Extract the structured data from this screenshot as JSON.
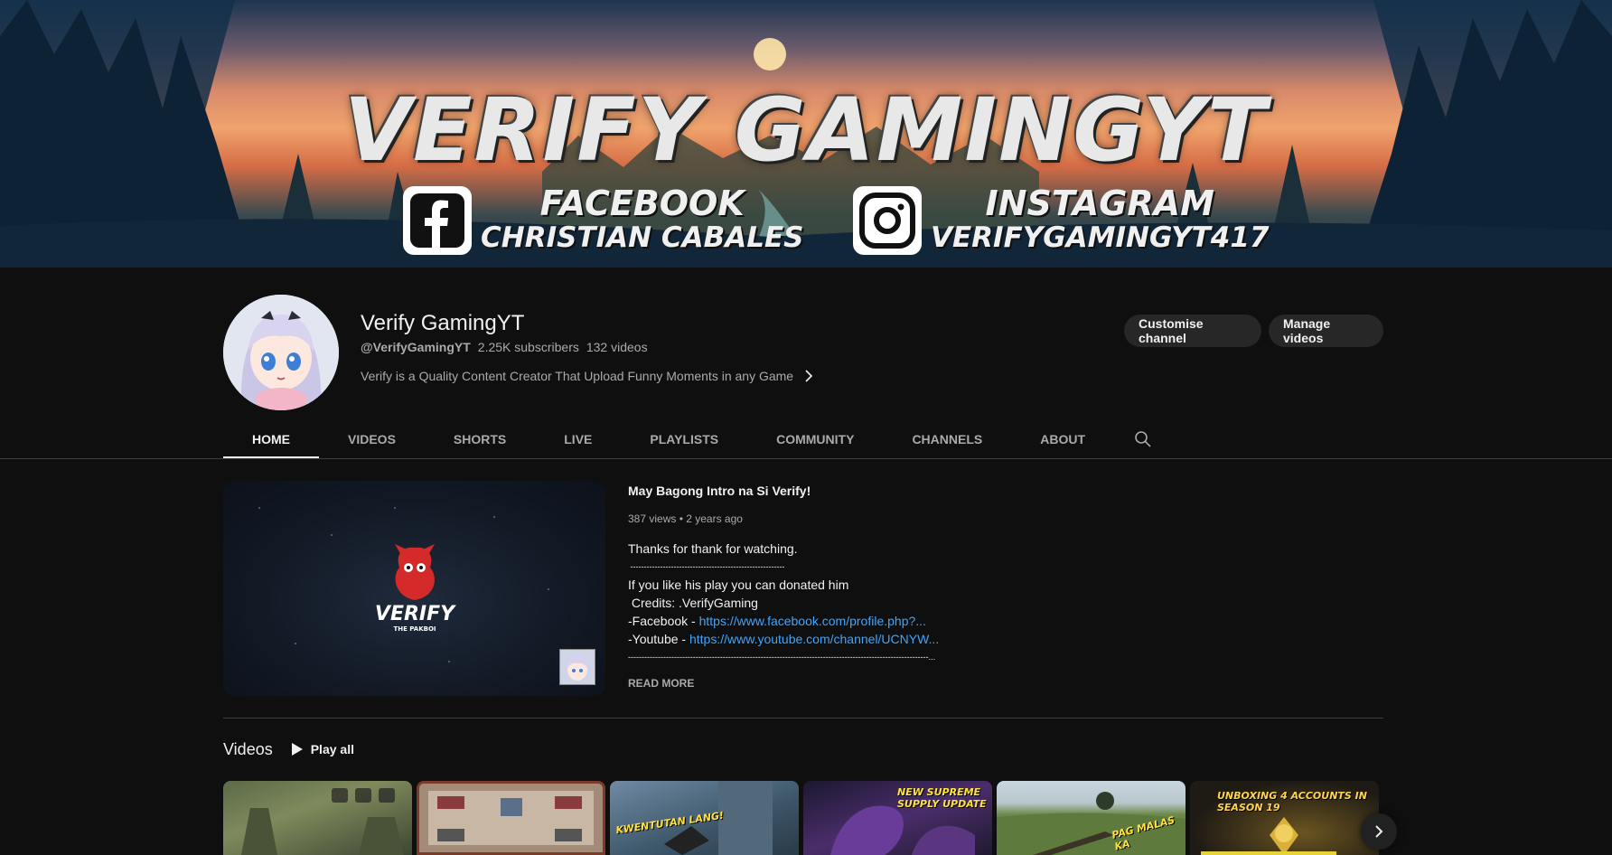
{
  "banner": {
    "title": "VERIFY GAMINGYT",
    "facebook": {
      "icon": "facebook-icon",
      "line1": "FACEBOOK",
      "line2": "CHRISTIAN CABALES"
    },
    "instagram": {
      "icon": "instagram-icon",
      "line1": "INSTAGRAM",
      "line2": "VERIFYGAMINGYT417"
    }
  },
  "channel": {
    "name": "Verify GamingYT",
    "handle": "@VerifyGamingYT",
    "subscribers": "2.25K subscribers",
    "videos": "132 videos",
    "description": "Verify is a Quality Content Creator That Upload Funny Moments in any Game",
    "customise_label": "Customise channel",
    "manage_label": "Manage videos"
  },
  "tabs": [
    {
      "label": "HOME",
      "active": true
    },
    {
      "label": "VIDEOS",
      "active": false
    },
    {
      "label": "SHORTS",
      "active": false
    },
    {
      "label": "LIVE",
      "active": false
    },
    {
      "label": "PLAYLISTS",
      "active": false
    },
    {
      "label": "COMMUNITY",
      "active": false
    },
    {
      "label": "CHANNELS",
      "active": false
    },
    {
      "label": "ABOUT",
      "active": false
    }
  ],
  "featured": {
    "title": "May Bagong Intro na Si Verify!",
    "views": "387 views",
    "age": "2 years ago",
    "thumb_logo_main": "VERIFY",
    "thumb_logo_sub": "THE PAKBOI",
    "desc_line1": "Thanks for thank for watching.",
    "desc_rule1": " ---------------------------------------------------------",
    "desc_line2": "If you like his play you can donated him",
    "desc_line3": " Credits: .VerifyGaming",
    "fb_prefix": "-Facebook - ",
    "fb_link": "https://www.facebook.com/profile.php?...",
    "yt_prefix": "-Youtube - ",
    "yt_link": "https://www.youtube.com/channel/UCNYW...",
    "desc_rule2": "---------------------------------------------------------------------------------------------------------------...",
    "read_more": "READ MORE"
  },
  "videos_shelf": {
    "title": "Videos",
    "play_all": "Play all",
    "thumbs": [
      {
        "caption": ""
      },
      {
        "caption": ""
      },
      {
        "caption": "KWENTUTAN LANG!"
      },
      {
        "caption": "NEW SUPREME SUPPLY UPDATE"
      },
      {
        "caption": "PAG MALAS KA"
      },
      {
        "caption": "UNBOXING 4 ACCOUNTS IN SEASON 19"
      }
    ]
  },
  "colors": {
    "bg": "#0f0f0f",
    "text": "#f1f1f1",
    "muted": "#aaaaaa",
    "link": "#3ea6ff",
    "button": "#272727"
  }
}
